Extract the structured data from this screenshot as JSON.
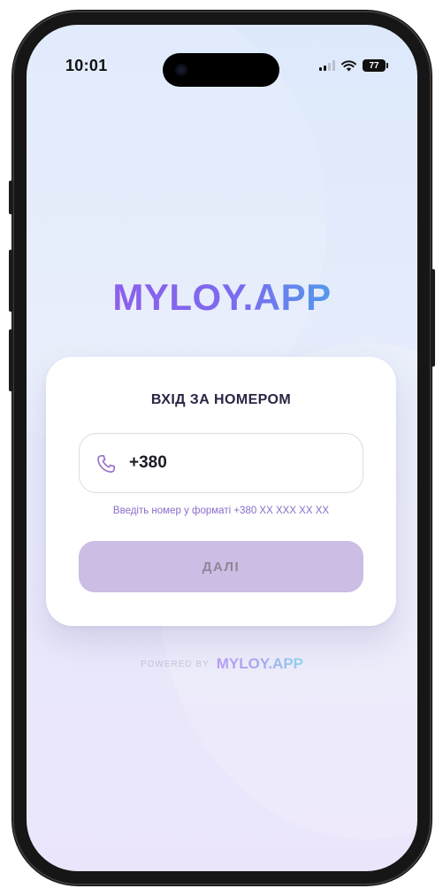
{
  "status_bar": {
    "time": "10:01",
    "battery": "77"
  },
  "logo": {
    "text": "MYLOY.APP"
  },
  "login_card": {
    "title": "ВХІД ЗА НОМЕРОМ",
    "phone_value": "+380",
    "hint": "Введіть номер у форматі +380 XX XXX XX XX",
    "next_label": "ДАЛІ"
  },
  "footer": {
    "powered_by": "POWERED BY",
    "brand": "MYLOY.APP"
  },
  "icons": {
    "phone_field": "phone-icon",
    "signal": "cellular-signal-icon",
    "wifi": "wifi-icon",
    "battery": "battery-icon"
  },
  "colors": {
    "accent_start": "#9b55e8",
    "accent_end": "#2ec4e6",
    "button_disabled": "#cbbde3",
    "hint_text": "#8a6cc8"
  }
}
